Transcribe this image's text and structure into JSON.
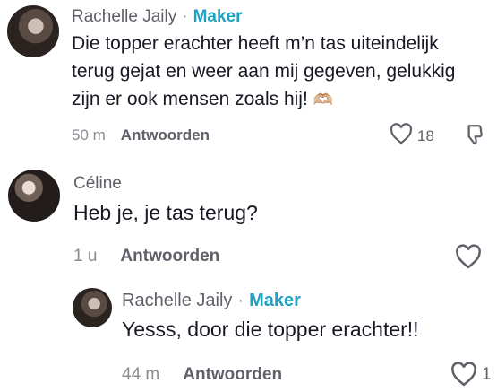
{
  "comments": [
    {
      "author": "Rachelle Jaily",
      "separator": "·",
      "badge": "Maker",
      "text": "Die topper erachter heeft m’n tas uiteindelijk terug gejat en weer aan mij gegeven, gelukkig zijn er ook mensen zoals hij!",
      "emoji": "🫶🏼",
      "time": "50 m",
      "reply_label": "Antwoorden",
      "like_count": "18",
      "like_icon": "heart-outline-icon",
      "dislike_icon": "thumbs-down-outline-icon"
    },
    {
      "author": "Céline",
      "text": "Heb je, je tas terug?",
      "time": "1 u",
      "reply_label": "Antwoorden",
      "like_icon": "heart-outline-icon"
    },
    {
      "author": "Rachelle Jaily",
      "separator": "·",
      "badge": "Maker",
      "text": "Yesss, door die topper erachter!!",
      "time": "44 m",
      "reply_label": "Antwoorden",
      "like_count": "1",
      "like_icon": "heart-outline-icon"
    }
  ],
  "colors": {
    "maker_badge": "#1fa1c3",
    "secondary_text": "#8a8b91",
    "primary_text": "#161823"
  }
}
